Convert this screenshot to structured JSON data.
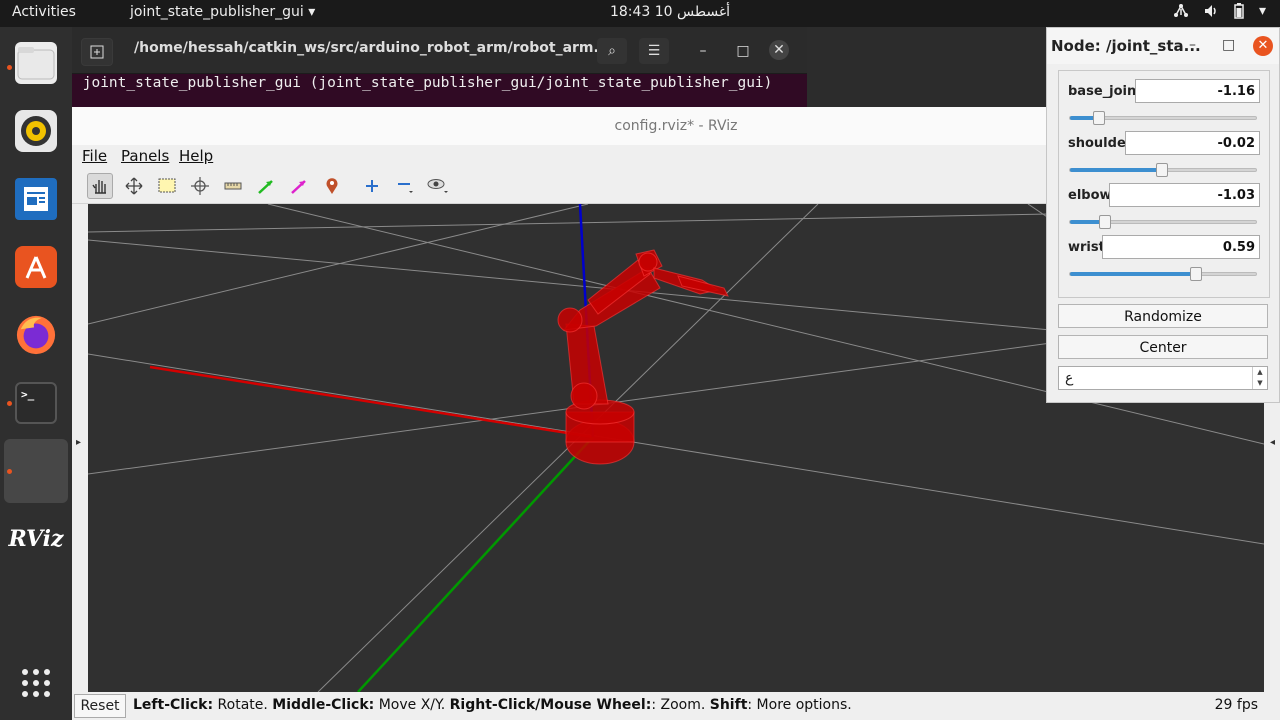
{
  "topbar": {
    "activities": "Activities",
    "app_menu": "joint_state_publisher_gui",
    "clock": "18:43  أغسطس 10"
  },
  "dock": {
    "items": [
      {
        "name": "files",
        "icon": "files-icon",
        "running": true
      },
      {
        "name": "rhythmbox",
        "icon": "rhythmbox-icon",
        "running": false
      },
      {
        "name": "libreoffice-writer",
        "icon": "writer-icon",
        "running": false
      },
      {
        "name": "ubuntu-software",
        "icon": "software-icon",
        "running": false
      },
      {
        "name": "firefox",
        "icon": "firefox-icon",
        "running": false
      },
      {
        "name": "terminal",
        "icon": "terminal-icon",
        "running": true
      },
      {
        "name": "blank-app",
        "icon": "blank-app-icon",
        "running": true
      },
      {
        "name": "rviz",
        "icon": "rviz-icon",
        "running": false
      }
    ],
    "rviz_label": "RViz",
    "terminal_glyph": ">_"
  },
  "terminal": {
    "title": "/home/hessah/catkin_ws/src/arduino_robot_arm/robot_arm...",
    "text": " joint_state_publisher_gui (joint_state_publisher_gui/joint_state_publisher_gui)"
  },
  "rviz": {
    "title": "config.rviz* - RViz",
    "menus": {
      "file": "File",
      "panels": "Panels",
      "help": "Help"
    },
    "toolbar": [
      "interact",
      "move-camera",
      "select",
      "focus-camera",
      "measure",
      "2d-pose-estimate",
      "2d-nav-goal",
      "publish-point",
      "add-tool",
      "remove-tool",
      "view-options"
    ],
    "status": {
      "reset": "Reset",
      "left_click_key": "Left-Click:",
      "left_click_val": " Rotate. ",
      "middle_click_key": "Middle-Click:",
      "middle_click_val": " Move X/Y. ",
      "right_click_key": "Right-Click/Mouse Wheel:",
      "right_click_val": ": Zoom. ",
      "shift_key": "Shift",
      "shift_val": ": More options."
    },
    "fps": "29 fps"
  },
  "joint_panel": {
    "title": "Node: /joint_sta...",
    "joints": [
      {
        "label": "base_joint",
        "value": "-1.16",
        "position": 0.155
      },
      {
        "label": "shoulder",
        "value": "-0.02",
        "position": 0.497
      },
      {
        "label": "elbow",
        "value": "-1.03",
        "position": 0.19
      },
      {
        "label": "wrist",
        "value": "0.59",
        "position": 0.675
      }
    ],
    "randomize": "Randomize",
    "center": "Center",
    "spin_value": "ع"
  },
  "colors": {
    "accent": "#e95420",
    "slider_fill": "#3d8fd0",
    "axis_x": "#d40000",
    "axis_y": "#009900",
    "axis_z": "#0000cc",
    "robot": "#c80000"
  }
}
